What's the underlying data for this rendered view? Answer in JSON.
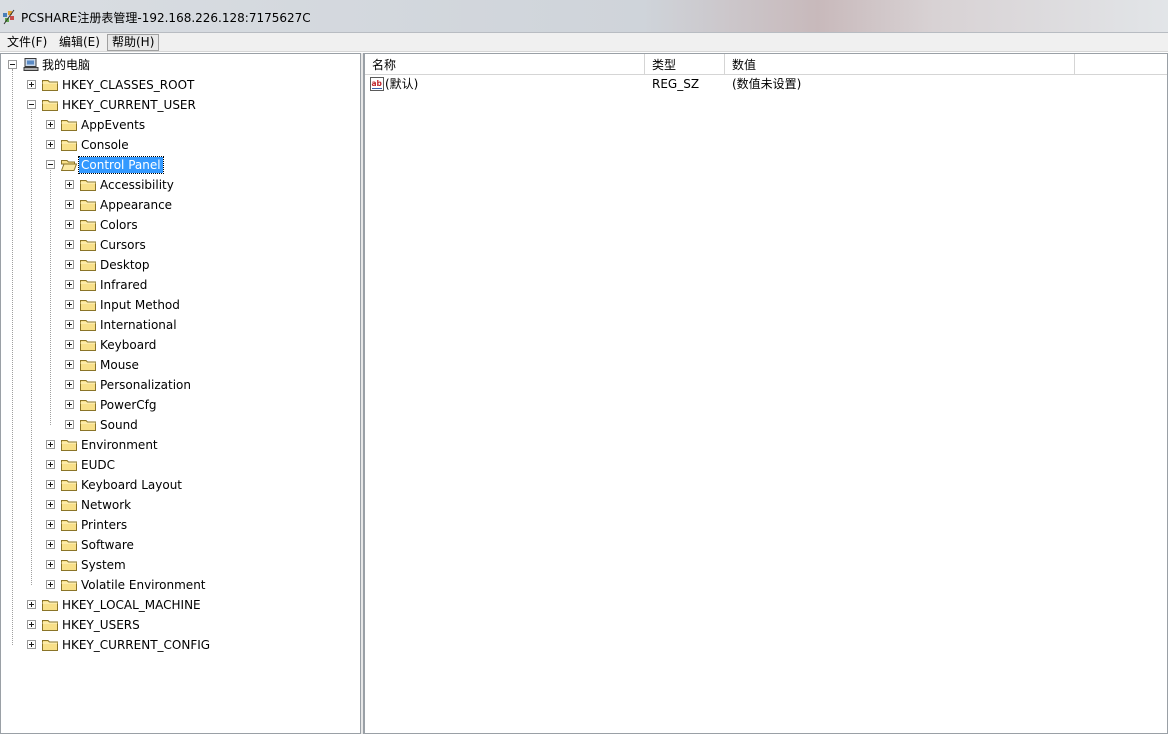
{
  "window": {
    "title": "PCSHARE注册表管理-192.168.226.128:7175627C"
  },
  "menu": {
    "file": "文件(F)",
    "edit": "编辑(E)",
    "help": "帮助(H)"
  },
  "tree": {
    "root": "我的电脑",
    "hives": {
      "classes_root": "HKEY_CLASSES_ROOT",
      "current_user": "HKEY_CURRENT_USER",
      "local_machine": "HKEY_LOCAL_MACHINE",
      "users": "HKEY_USERS",
      "current_config": "HKEY_CURRENT_CONFIG"
    },
    "current_user_children": {
      "appevents": "AppEvents",
      "console": "Console",
      "control_panel": "Control Panel",
      "environment": "Environment",
      "eudc": "EUDC",
      "keyboard_layout": "Keyboard Layout",
      "network": "Network",
      "printers": "Printers",
      "software": "Software",
      "system": "System",
      "volatile_environment": "Volatile Environment"
    },
    "control_panel_children": [
      "Accessibility",
      "Appearance",
      "Colors",
      "Cursors",
      "Desktop",
      "Infrared",
      "Input Method",
      "International",
      "Keyboard",
      "Mouse",
      "Personalization",
      "PowerCfg",
      "Sound"
    ]
  },
  "list": {
    "columns": {
      "name": "名称",
      "type": "类型",
      "data": "数值"
    },
    "rows": [
      {
        "name": "(默认)",
        "type": "REG_SZ",
        "data": "(数值未设置)"
      }
    ]
  }
}
